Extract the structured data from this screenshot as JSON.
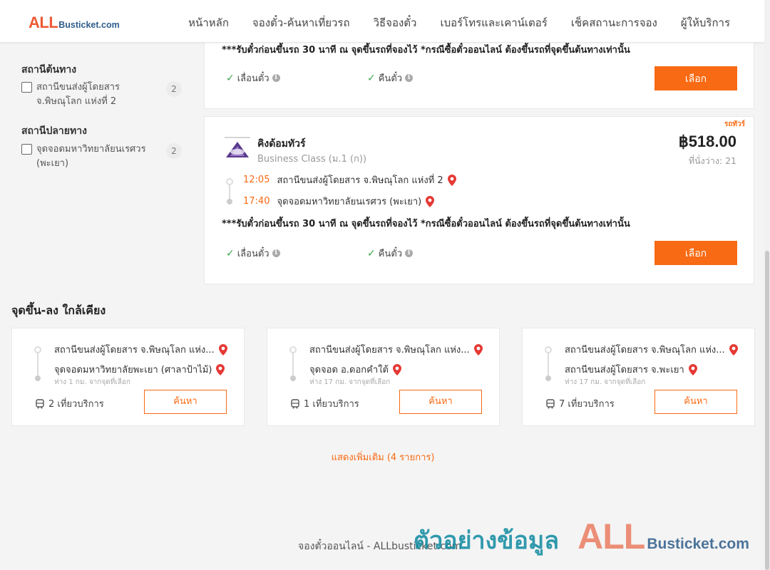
{
  "header": {
    "logo_big": "ALL",
    "logo_small": "Busticket.com",
    "nav": [
      "หน้าหลัก",
      "จองตั๋ว-ค้นหาเที่ยวรถ",
      "วิธีจองตั๋ว",
      "เบอร์โทรและเคาน์เตอร์",
      "เช็คสถานะการจอง",
      "ผู้ให้บริการ"
    ]
  },
  "filters": {
    "origin_title": "สถานีต้นทาง",
    "origin_items": [
      {
        "label": "สถานีขนส่งผู้โดยสาร จ.พิษณุโลก แห่งที่ 2",
        "count": "2"
      }
    ],
    "dest_title": "สถานีปลายทาง",
    "dest_items": [
      {
        "label": "จุดจอดมหาวิทยาลัยนเรศวร (พะเยา)",
        "count": "2"
      }
    ]
  },
  "trip1": {
    "note": "***รับตั๋วก่อนขึ้นรถ 30 นาที ณ จุดขึ้นรถที่จองไว้ *กรณีซื้อตั๋วออนไลน์ ต้องขึ้นรถที่จุดขึ้นต้นทางเท่านั้น",
    "feature_change": "เลื่อนตั๋ว",
    "feature_refund": "คืนตั๋ว",
    "select_label": "เลือก"
  },
  "trip2": {
    "ribbon": "รถทัวร์",
    "operator": "คิงด้อมทัวร์",
    "class": "Business Class (ม.1 (ก))",
    "price": "฿518.00",
    "seats": "ที่นั่งว่าง: 21",
    "depart_time": "12:05",
    "depart_station": "สถานีขนส่งผู้โดยสาร จ.พิษณุโลก แห่งที่ 2",
    "arrive_time": "17:40",
    "arrive_station": "จุดจอดมหาวิทยาลัยนเรศวร (พะเยา)",
    "note": "***รับตั๋วก่อนขึ้นรถ 30 นาที ณ จุดขึ้นรถที่จองไว้ *กรณีซื้อตั๋วออนไลน์ ต้องขึ้นรถที่จุดขึ้นต้นทางเท่านั้น",
    "feature_change": "เลื่อนตั๋ว",
    "feature_refund": "คืนตั๋ว",
    "select_label": "เลือก"
  },
  "nearby": {
    "title": "จุดขึ้น-ลง ใกล้เคียง",
    "cards": [
      {
        "from": "สถานีขนส่งผู้โดยสาร จ.พิษณุโลก แห่ง...",
        "to": "จุดจอดมหาวิทยาลัยพะเยา (ศาลาป้าไม้)",
        "dist": "ห่าง 1 กม. จากจุดที่เลือก",
        "trips": "2 เที่ยวบริการ",
        "button": "ค้นหา"
      },
      {
        "from": "สถานีขนส่งผู้โดยสาร จ.พิษณุโลก แห่ง...",
        "to": "จุดจอด อ.ดอกคำใต้",
        "dist": "ห่าง 17 กม. จากจุดที่เลือก",
        "trips": "1 เที่ยวบริการ",
        "button": "ค้นหา"
      },
      {
        "from": "สถานีขนส่งผู้โดยสาร จ.พิษณุโลก แห่ง...",
        "to": "สถานีขนส่งผู้โดยสาร จ.พะเยา",
        "dist": "ห่าง 17 กม. จากจุดที่เลือก",
        "trips": "7 เที่ยวบริการ",
        "button": "ค้นหา"
      }
    ],
    "show_more": "แสดงเพิ่มเติม (4 รายการ)"
  },
  "footer": {
    "text": "จองตั๋วออนไลน์ - ALLbusticket.com",
    "watermark_th": "ตัวอย่างข้อมูล",
    "watermark_all": "ALL",
    "watermark_bt": "Busticket.com"
  },
  "colors": {
    "accent": "#f86a13",
    "logo_red": "#ee5a34",
    "logo_blue": "#2f5d8a",
    "check_green": "#3aa74a",
    "watermark_teal": "#0f8aa0"
  }
}
